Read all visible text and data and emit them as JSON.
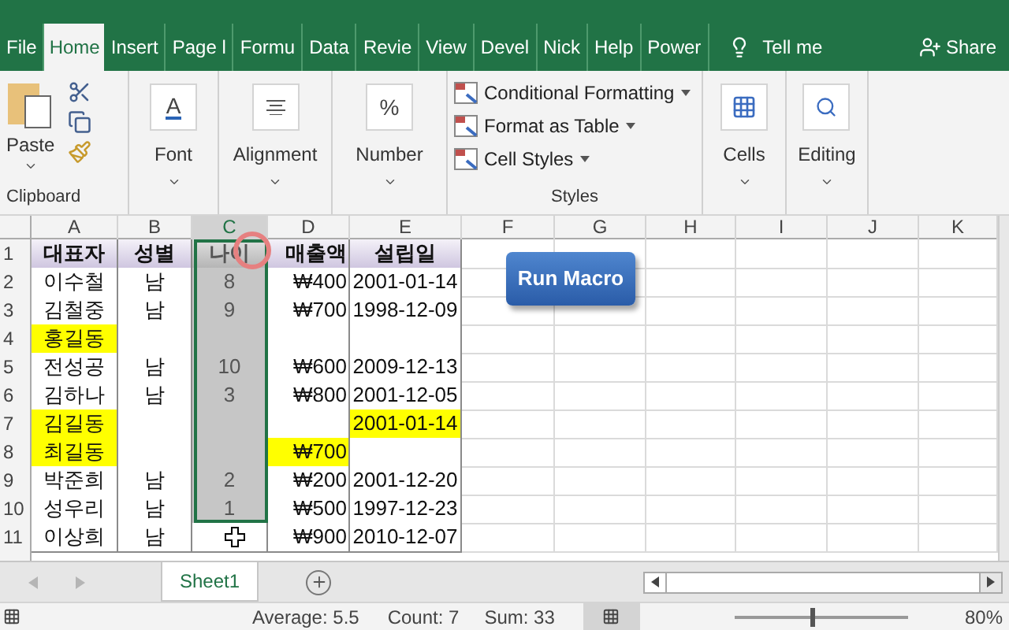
{
  "ribbon_tabs": [
    {
      "label": "File",
      "selected": false
    },
    {
      "label": "Home",
      "selected": true
    },
    {
      "label": "Insert",
      "selected": false
    },
    {
      "label": "Page l",
      "selected": false
    },
    {
      "label": "Formu",
      "selected": false
    },
    {
      "label": "Data",
      "selected": false
    },
    {
      "label": "Revie",
      "selected": false
    },
    {
      "label": "View",
      "selected": false
    },
    {
      "label": "Devel",
      "selected": false
    },
    {
      "label": "Nick",
      "selected": false
    },
    {
      "label": "Help",
      "selected": false
    },
    {
      "label": "Power",
      "selected": false
    }
  ],
  "tell_me": "Tell me",
  "share": "Share",
  "ribbon": {
    "clipboard": {
      "paste": "Paste",
      "label": "Clipboard"
    },
    "font_icon": "A",
    "number_icon": "%",
    "font": "Font",
    "alignment": "Alignment",
    "number": "Number",
    "styles": {
      "items": [
        "Conditional Formatting",
        "Format as Table",
        "Cell Styles"
      ],
      "label": "Styles"
    },
    "cells": "Cells",
    "editing": "Editing"
  },
  "columns": [
    {
      "label": "A",
      "selected": false
    },
    {
      "label": "B",
      "selected": false
    },
    {
      "label": "C",
      "selected": true
    },
    {
      "label": "D",
      "selected": false
    },
    {
      "label": "E",
      "selected": false
    },
    {
      "label": "F",
      "selected": false
    },
    {
      "label": "G",
      "selected": false
    },
    {
      "label": "H",
      "selected": false
    },
    {
      "label": "I",
      "selected": false
    },
    {
      "label": "J",
      "selected": false
    },
    {
      "label": "K",
      "selected": false
    }
  ],
  "rows": [
    {
      "number": "1",
      "kind": "header",
      "cells": [
        {
          "text": "대표자",
          "highlighted": false,
          "selected": false
        },
        {
          "text": "성별",
          "highlighted": false,
          "selected": false
        },
        {
          "text": "나이",
          "highlighted": false,
          "selected": true
        },
        {
          "text": "매출액",
          "highlighted": false,
          "selected": false
        },
        {
          "text": "설립일",
          "highlighted": false,
          "selected": false
        }
      ]
    },
    {
      "number": "2",
      "kind": "data",
      "cells": [
        {
          "text": "이수철",
          "highlighted": false,
          "selected": false
        },
        {
          "text": "남",
          "highlighted": false,
          "selected": false
        },
        {
          "text": "8",
          "highlighted": false,
          "selected": true
        },
        {
          "text": "₩400",
          "highlighted": false,
          "selected": false
        },
        {
          "text": "2001-01-14",
          "highlighted": false,
          "selected": false
        }
      ]
    },
    {
      "number": "3",
      "kind": "data",
      "cells": [
        {
          "text": "김철중",
          "highlighted": false,
          "selected": false
        },
        {
          "text": "남",
          "highlighted": false,
          "selected": false
        },
        {
          "text": "9",
          "highlighted": false,
          "selected": true
        },
        {
          "text": "₩700",
          "highlighted": false,
          "selected": false
        },
        {
          "text": "1998-12-09",
          "highlighted": false,
          "selected": false
        }
      ]
    },
    {
      "number": "4",
      "kind": "data",
      "cells": [
        {
          "text": "홍길동",
          "highlighted": true,
          "selected": false
        },
        {
          "highlighted": false,
          "selected": false
        },
        {
          "highlighted": false,
          "selected": true
        },
        {
          "highlighted": false,
          "selected": false
        },
        {
          "highlighted": false,
          "selected": false
        }
      ]
    },
    {
      "number": "5",
      "kind": "data",
      "cells": [
        {
          "text": "전성공",
          "highlighted": false,
          "selected": false
        },
        {
          "text": "남",
          "highlighted": false,
          "selected": false
        },
        {
          "text": "10",
          "highlighted": false,
          "selected": true
        },
        {
          "text": "₩600",
          "highlighted": false,
          "selected": false
        },
        {
          "text": "2009-12-13",
          "highlighted": false,
          "selected": false
        }
      ]
    },
    {
      "number": "6",
      "kind": "data",
      "cells": [
        {
          "text": "김하나",
          "highlighted": false,
          "selected": false
        },
        {
          "text": "남",
          "highlighted": false,
          "selected": false
        },
        {
          "text": "3",
          "highlighted": false,
          "selected": true
        },
        {
          "text": "₩800",
          "highlighted": false,
          "selected": false
        },
        {
          "text": "2001-12-05",
          "highlighted": false,
          "selected": false
        }
      ]
    },
    {
      "number": "7",
      "kind": "data",
      "cells": [
        {
          "text": "김길동",
          "highlighted": true,
          "selected": false
        },
        {
          "highlighted": false,
          "selected": false
        },
        {
          "highlighted": false,
          "selected": true
        },
        {
          "highlighted": false,
          "selected": false
        },
        {
          "text": "2001-01-14",
          "highlighted": true,
          "selected": false
        }
      ]
    },
    {
      "number": "8",
      "kind": "data",
      "cells": [
        {
          "text": "최길동",
          "highlighted": true,
          "selected": false
        },
        {
          "highlighted": false,
          "selected": false
        },
        {
          "highlighted": false,
          "selected": true
        },
        {
          "text": "₩700",
          "highlighted": true,
          "selected": false
        },
        {
          "highlighted": false,
          "selected": false
        }
      ]
    },
    {
      "number": "9",
      "kind": "data",
      "cells": [
        {
          "text": "박준희",
          "highlighted": false,
          "selected": false
        },
        {
          "text": "남",
          "highlighted": false,
          "selected": false
        },
        {
          "text": "2",
          "highlighted": false,
          "selected": true
        },
        {
          "text": "₩200",
          "highlighted": false,
          "selected": false
        },
        {
          "text": "2001-12-20",
          "highlighted": false,
          "selected": false
        }
      ]
    },
    {
      "number": "10",
      "kind": "data",
      "cells": [
        {
          "text": "성우리",
          "highlighted": false,
          "selected": false
        },
        {
          "text": "남",
          "highlighted": false,
          "selected": false
        },
        {
          "text": "1",
          "highlighted": false,
          "selected": true
        },
        {
          "text": "₩500",
          "highlighted": false,
          "selected": false
        },
        {
          "text": "1997-12-23",
          "highlighted": false,
          "selected": false
        }
      ]
    },
    {
      "number": "11",
      "kind": "data",
      "cells": [
        {
          "text": "이상희",
          "highlighted": false,
          "selected": false
        },
        {
          "text": "남",
          "highlighted": false,
          "selected": false
        },
        {
          "highlighted": false,
          "selected": false
        },
        {
          "text": "₩900",
          "highlighted": false,
          "selected": false
        },
        {
          "text": "2010-12-07",
          "highlighted": false,
          "selected": false
        }
      ]
    }
  ],
  "macro_button": "Run Macro",
  "sheet_tabs": [
    {
      "label": "Sheet1",
      "selected": true
    }
  ],
  "status_bar": {
    "average": "Average: 5.5",
    "count": "Count: 7",
    "sum": "Sum: 33",
    "zoom": "80%",
    "zoom_level": {
      "level": 0.45
    }
  }
}
